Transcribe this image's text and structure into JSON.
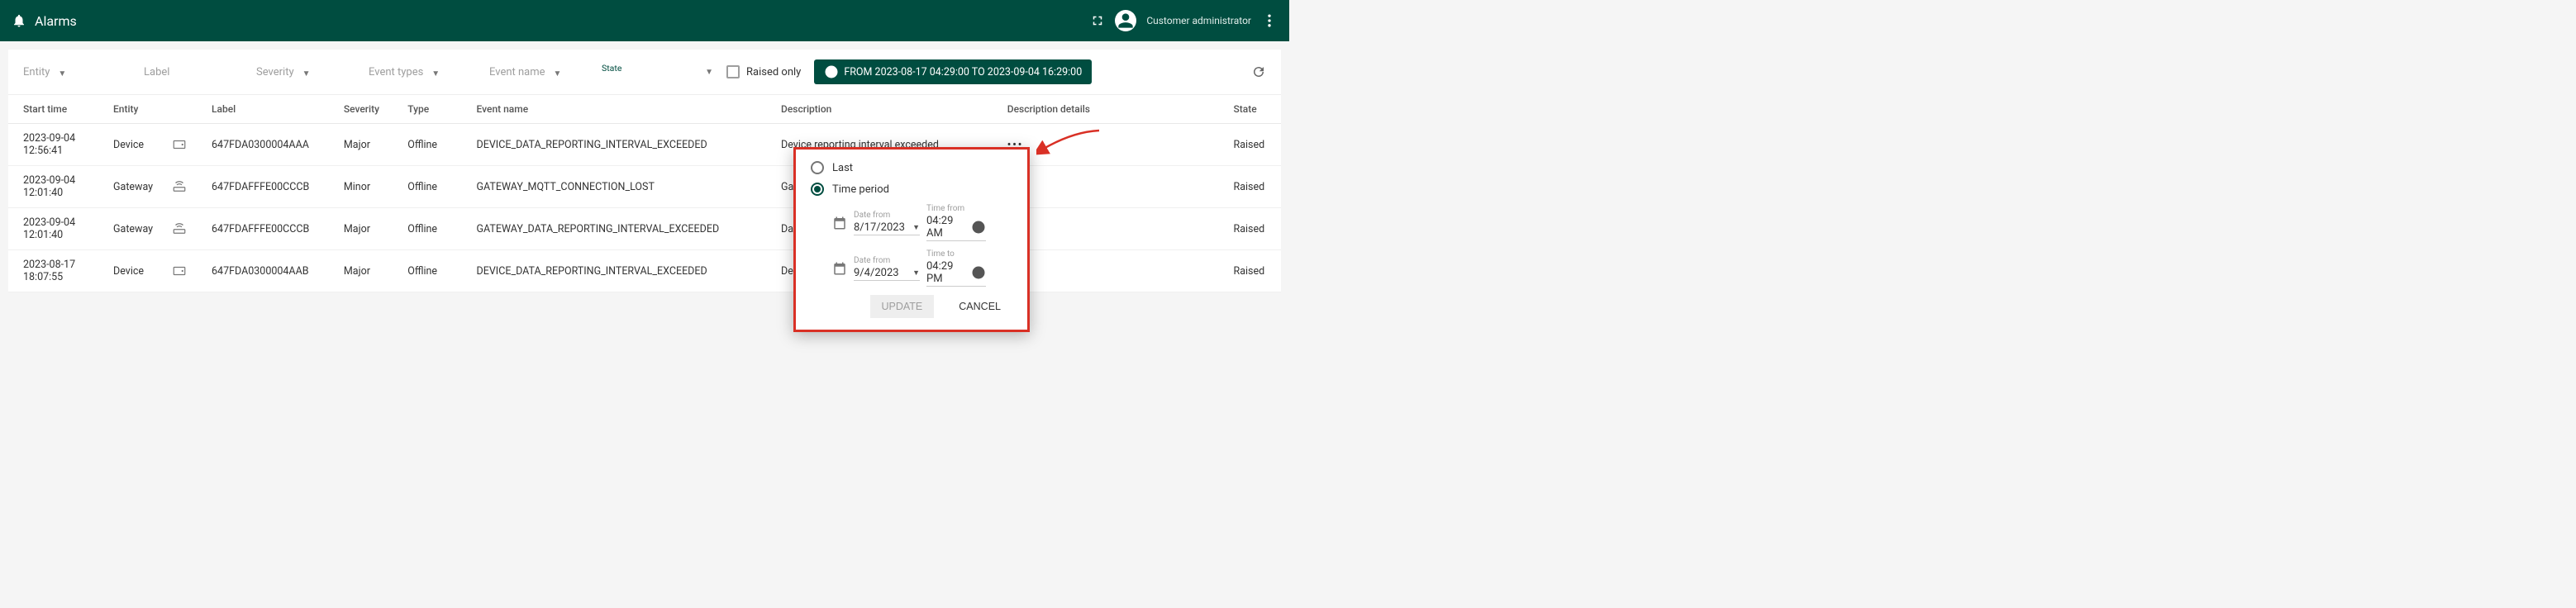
{
  "header": {
    "title": "Alarms",
    "user_role": "Customer administrator"
  },
  "filters": {
    "entity": "Entity",
    "label": "Label",
    "severity": "Severity",
    "event_types": "Event types",
    "event_name": "Event name",
    "state": "State",
    "raised_only": "Raised only",
    "range_label": "FROM 2023-08-17 04:29:00 TO 2023-09-04 16:29:00"
  },
  "columns": {
    "start": "Start time",
    "entity": "Entity",
    "label": "Label",
    "severity": "Severity",
    "type": "Type",
    "event_name": "Event name",
    "description": "Description",
    "desc_details": "Description details",
    "state": "State"
  },
  "rows": [
    {
      "start": "2023-09-04 12:56:41",
      "entity": "Device",
      "entity_kind": "device",
      "label": "647FDA0300004AAA",
      "severity": "Major",
      "type": "Offline",
      "event_name": "DEVICE_DATA_REPORTING_INTERVAL_EXCEEDED",
      "description": "Device reporting interval exceeded",
      "state": "Raised"
    },
    {
      "start": "2023-09-04 12:01:40",
      "entity": "Gateway",
      "entity_kind": "gateway",
      "label": "647FDAFFFE00CCCB",
      "severity": "Minor",
      "type": "Offline",
      "event_name": "GATEWAY_MQTT_CONNECTION_LOST",
      "description": "Gateway MQTT connection with Server is lost",
      "state": "Raised"
    },
    {
      "start": "2023-09-04 12:01:40",
      "entity": "Gateway",
      "entity_kind": "gateway",
      "label": "647FDAFFFE00CCCB",
      "severity": "Major",
      "type": "Offline",
      "event_name": "GATEWAY_DATA_REPORTING_INTERVAL_EXCEEDED",
      "description": "Data is not received from the Gateway",
      "state": "Raised"
    },
    {
      "start": "2023-08-17 18:07:55",
      "entity": "Device",
      "entity_kind": "device",
      "label": "647FDA0300004AAB",
      "severity": "Major",
      "type": "Offline",
      "event_name": "DEVICE_DATA_REPORTING_INTERVAL_EXCEEDED",
      "description": "Device reporting interval exceeded",
      "state": "Raised"
    }
  ],
  "popup": {
    "opt_last": "Last",
    "opt_period": "Time period",
    "date_from_lbl": "Date from",
    "time_from_lbl": "Time from",
    "time_to_lbl": "Time to",
    "date_from": "8/17/2023",
    "time_from": "04:29 AM",
    "date_to": "9/4/2023",
    "time_to": "04:29 PM",
    "update": "UPDATE",
    "cancel": "CANCEL"
  },
  "colors": {
    "brand": "#004d40",
    "highlight": "#d93025"
  }
}
